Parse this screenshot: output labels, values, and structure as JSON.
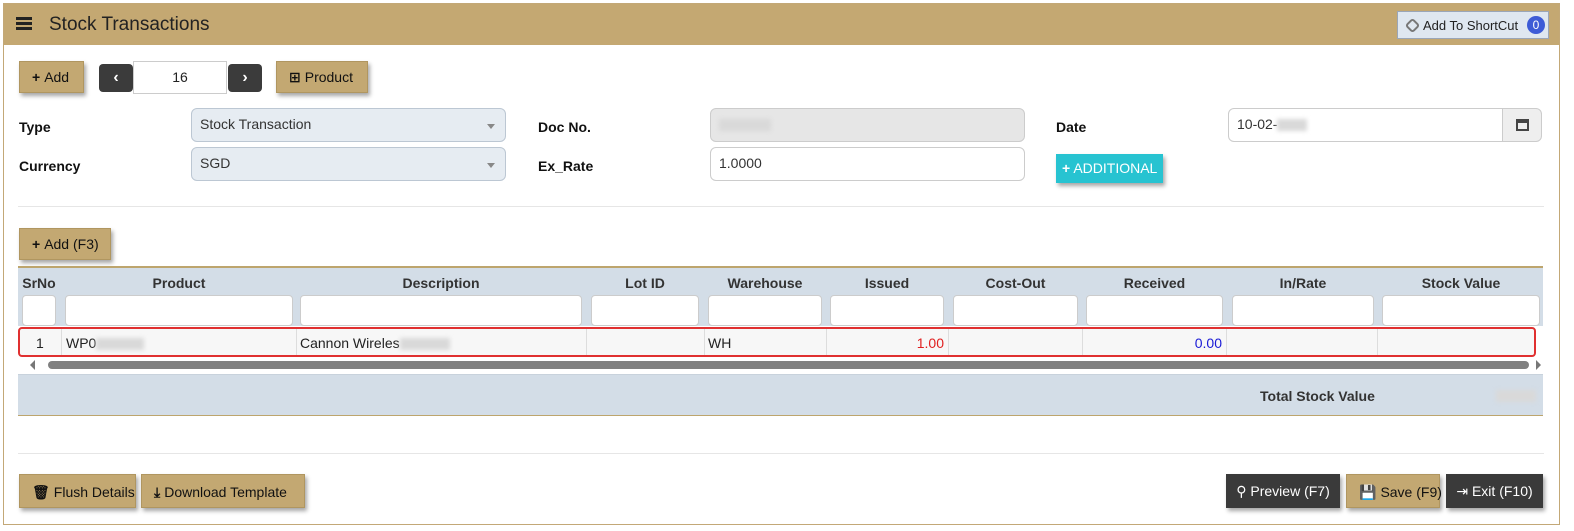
{
  "header": {
    "title": "Stock Transactions",
    "shortcut_label": "Add To ShortCut",
    "shortcut_count": "0"
  },
  "toolbar": {
    "add_label": "Add",
    "record_number": "16",
    "product_label": "Product"
  },
  "form": {
    "type_label": "Type",
    "type_value": "Stock Transaction",
    "currency_label": "Currency",
    "currency_value": "SGD",
    "docno_label": "Doc No.",
    "exrate_label": "Ex_Rate",
    "exrate_value": "1.0000",
    "date_label": "Date",
    "date_value": "10-02-",
    "additional_label": "ADDITIONAL"
  },
  "grid": {
    "add_label": "Add (F3)",
    "columns": [
      "SrNo",
      "Product",
      "Description",
      "Lot ID",
      "Warehouse",
      "Issued",
      "Cost-Out",
      "Received",
      "In/Rate",
      "Stock Value"
    ],
    "rows": [
      {
        "srno": "1",
        "product": "WP0",
        "description": "Cannon Wireles",
        "lot_id": "",
        "warehouse": "WH",
        "issued": "1.00",
        "cost_out": "",
        "received": "0.00",
        "in_rate": "",
        "stock_value": ""
      }
    ],
    "total_label": "Total Stock Value"
  },
  "footer": {
    "flush_label": "Flush Details",
    "download_label": "Download Template",
    "preview_label": "Preview (F7)",
    "save_label": "Save (F9)",
    "exit_label": "Exit (F10)"
  },
  "colors": {
    "header_bg": "#c4a872",
    "issued_text": "#e02020",
    "received_text": "#1a1ad6",
    "additional_bg": "#27c3d1",
    "row_highlight_border": "#e03030"
  },
  "icons": {
    "menu": "hamburger-icon",
    "shortcut": "link-icon",
    "add": "plus-icon",
    "prev": "chevron-left-icon",
    "next": "chevron-right-icon",
    "product": "gift-icon",
    "calendar": "calendar-icon",
    "flush": "trash-icon",
    "download": "download-icon",
    "preview": "search-icon",
    "save": "floppy-icon",
    "exit": "sign-out-icon"
  }
}
